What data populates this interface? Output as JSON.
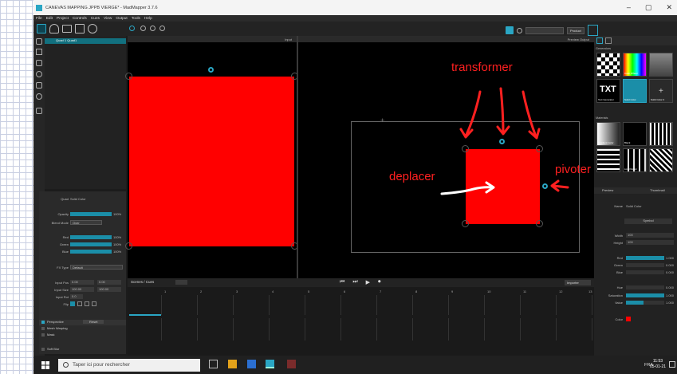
{
  "window": {
    "title": "CANEVAS MAPPING JPPB VIERGE* - MadMapper 3.7.6",
    "minimize": "–",
    "maximize": "▢",
    "close": "✕"
  },
  "menu": [
    "File",
    "Edit",
    "Project",
    "Controls",
    "Cues",
    "View",
    "Output",
    "Tools",
    "Help"
  ],
  "toolbar": {
    "product_button": "Product"
  },
  "layers": {
    "items": [
      {
        "label": "Quad 1 Quad1"
      }
    ]
  },
  "properties": {
    "header": {
      "label": "Quad",
      "value": "Solid Color"
    },
    "opacity": {
      "label": "Opacity",
      "value": "100%"
    },
    "blend": {
      "label": "Blend Mode",
      "value": "Over"
    },
    "rgb": [
      {
        "label": "Red",
        "value": "100%"
      },
      {
        "label": "Green",
        "value": "100%"
      },
      {
        "label": "Blue",
        "value": "100%"
      }
    ],
    "fx": {
      "label": "FX Type",
      "value": "Default"
    },
    "input_pos": {
      "label": "Input Pos",
      "x": "0.00",
      "y": "0.00"
    },
    "input_size": {
      "label": "Input Size",
      "x": "100.00",
      "y": "100.00"
    },
    "input_rot": {
      "label": "Input Rot",
      "value": "0.0"
    },
    "flip": {
      "label": "Flip"
    },
    "perspective": {
      "label": "Perspective",
      "reset": "Reset"
    },
    "mesh": {
      "label": "Mesh Warping"
    },
    "mask": {
      "label": "Mask"
    },
    "soft": {
      "label": "Soft Blur"
    }
  },
  "views": {
    "input_label": "Input",
    "output_label": "Preview Output"
  },
  "annotations": {
    "transformer": "transformer",
    "deplacer": "deplacer",
    "pivoter": "pivoter"
  },
  "timeline": {
    "tab": "Scenes / Cues",
    "export": "Importer",
    "transport": [
      "⏮",
      "⏭",
      "▶",
      "⏺"
    ],
    "ticks": [
      "1",
      "2",
      "3",
      "4",
      "5",
      "6",
      "7",
      "8",
      "9",
      "10",
      "11",
      "12",
      "13"
    ]
  },
  "library": {
    "generators_title": "Generators",
    "generators": [
      "",
      "Color Wheel",
      "",
      "Text Generator",
      "Solid Color",
      "Solid Color 2"
    ],
    "textures_title": "Materials",
    "textures": [
      "Gradient Color",
      "Black",
      "",
      "",
      "Line Pattern",
      "",
      "",
      ""
    ],
    "plus": "+"
  },
  "right_props": {
    "section": "Preview",
    "section_value": "Thumbnail",
    "name": {
      "label": "Name",
      "value": "Solid Color"
    },
    "action_button": "Symbol",
    "width": {
      "label": "Width",
      "value": "100"
    },
    "height": {
      "label": "Height",
      "value": "100"
    },
    "red": {
      "label": "Red",
      "value": "1.000",
      "level": 1.0
    },
    "green": {
      "label": "Green",
      "value": "0.000",
      "level": 0.0
    },
    "blue": {
      "label": "Blue",
      "value": "0.000",
      "level": 0.0
    },
    "hue": {
      "label": "Hue",
      "value": "0.000",
      "level": 0.0
    },
    "saturation": {
      "label": "Saturation",
      "value": "1.000",
      "level": 1.0
    },
    "value": {
      "label": "Value",
      "value": "1.000",
      "level": 0.45
    },
    "color": {
      "label": "Color"
    }
  },
  "taskbar": {
    "search_placeholder": "Taper ici pour rechercher",
    "lang": "FRA",
    "time": "11:53",
    "date": "05-01-21"
  },
  "colors": {
    "accent": "#2aa6c4",
    "red": "#ff0000",
    "annotation": "#ff2020"
  }
}
